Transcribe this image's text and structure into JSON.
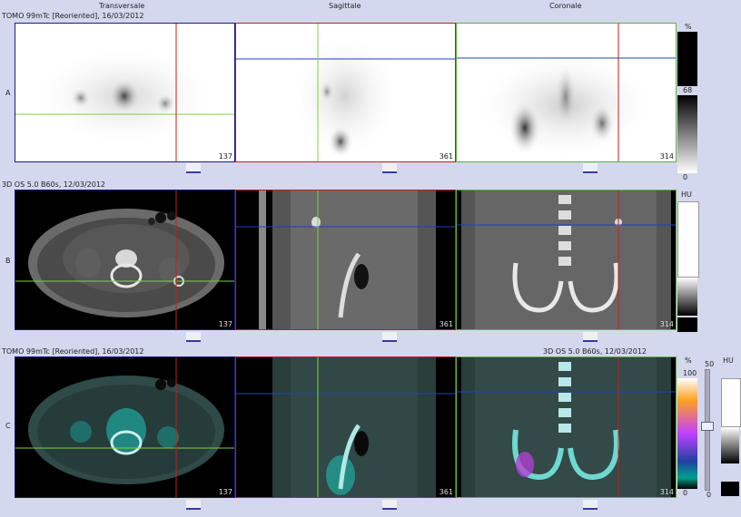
{
  "columns": {
    "transverse": "Transversale",
    "sagittal": "Sagittale",
    "coronal": "Coronale"
  },
  "rows": {
    "a": {
      "letter": "A",
      "caption": "TOMO 99mTc [Reoriented], 16/03/2012"
    },
    "b": {
      "letter": "B",
      "caption": "3D  OS  5.0  B60s, 12/03/2012"
    },
    "c": {
      "letter": "C",
      "caption_left": "TOMO 99mTc [Reoriented], 16/03/2012",
      "caption_right": "3D  OS  5.0  B60s, 12/03/2012"
    }
  },
  "slices": {
    "transverse": "137",
    "sagittal": "361",
    "coronal": "314"
  },
  "scales": {
    "a": {
      "unit": "%",
      "top": "68",
      "bottom": "0"
    },
    "b": {
      "unit": "HU"
    },
    "c": {
      "unit": "%",
      "top": "100",
      "bottom": "0",
      "mid_unit": "50",
      "mid_bottom": "0",
      "right_unit": "HU"
    }
  },
  "colors": {
    "crosshair_red": "#c02020",
    "crosshair_green": "#80d040",
    "crosshair_blue": "#2040c0",
    "frame_navy": "#1a1a7a",
    "frame_red": "#c02020",
    "frame_green": "#60b040"
  }
}
